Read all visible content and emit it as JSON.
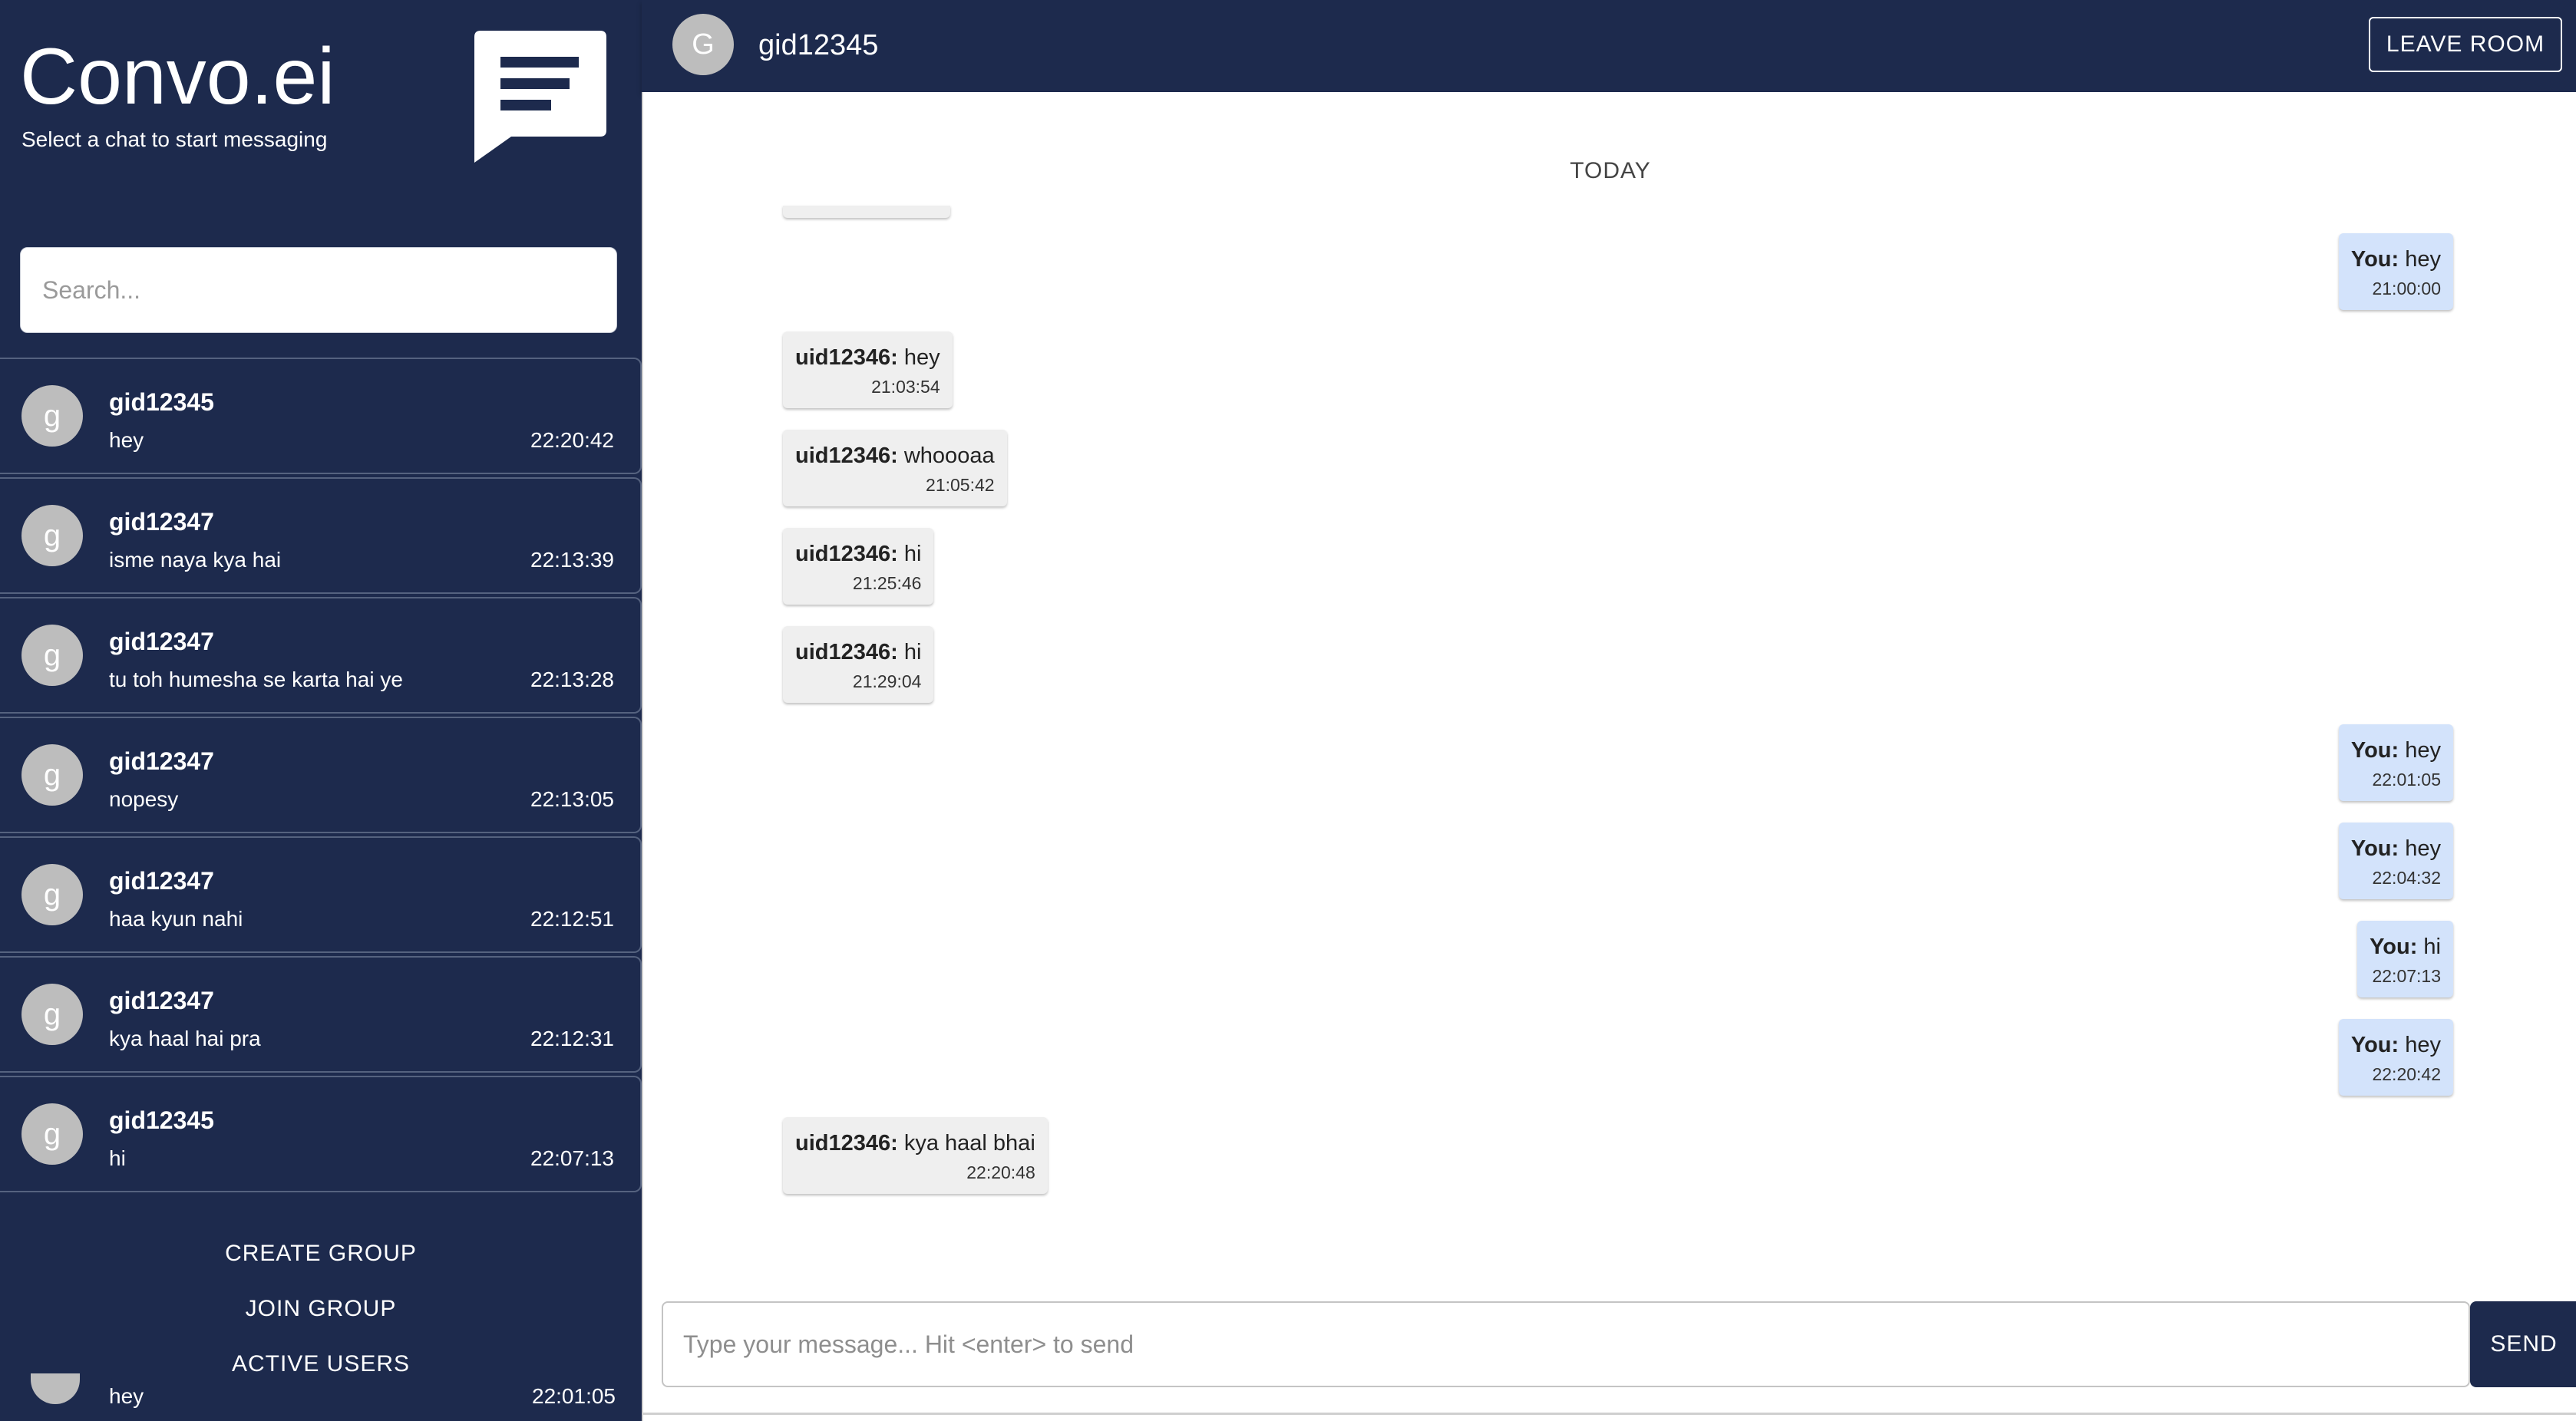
{
  "sidebar": {
    "brand_title": "Convo.ei",
    "brand_subtitle": "Select a chat to start messaging",
    "search_placeholder": "Search...",
    "conversations": [
      {
        "avatar": "g",
        "name": "gid12345",
        "last_message": "hey",
        "time": "22:20:42"
      },
      {
        "avatar": "g",
        "name": "gid12347",
        "last_message": "isme naya kya hai",
        "time": "22:13:39"
      },
      {
        "avatar": "g",
        "name": "gid12347",
        "last_message": "tu toh humesha se karta hai ye",
        "time": "22:13:28"
      },
      {
        "avatar": "g",
        "name": "gid12347",
        "last_message": "nopesy",
        "time": "22:13:05"
      },
      {
        "avatar": "g",
        "name": "gid12347",
        "last_message": "haa kyun nahi",
        "time": "22:12:51"
      },
      {
        "avatar": "g",
        "name": "gid12347",
        "last_message": "kya haal hai pra",
        "time": "22:12:31"
      },
      {
        "avatar": "g",
        "name": "gid12345",
        "last_message": "hi",
        "time": "22:07:13"
      }
    ],
    "partial_conversation": {
      "last_message": "hey",
      "time": "22:01:05"
    },
    "actions": {
      "create_group": "CREATE GROUP",
      "join_group": "JOIN GROUP",
      "active_users": "ACTIVE USERS"
    }
  },
  "header": {
    "avatar": "G",
    "room_name": "gid12345",
    "leave_button": "LEAVE ROOM"
  },
  "chat": {
    "day_separator": "TODAY",
    "messages": [
      {
        "direction": "out",
        "sender": "You:",
        "text": "hey",
        "time": "21:00:00"
      },
      {
        "direction": "in",
        "sender": "uid12346:",
        "text": "hey",
        "time": "21:03:54"
      },
      {
        "direction": "in",
        "sender": "uid12346:",
        "text": "whoooaa",
        "time": "21:05:42"
      },
      {
        "direction": "in",
        "sender": "uid12346:",
        "text": "hi",
        "time": "21:25:46"
      },
      {
        "direction": "in",
        "sender": "uid12346:",
        "text": "hi",
        "time": "21:29:04"
      },
      {
        "direction": "out",
        "sender": "You:",
        "text": "hey",
        "time": "22:01:05"
      },
      {
        "direction": "out",
        "sender": "You:",
        "text": "hey",
        "time": "22:04:32"
      },
      {
        "direction": "out",
        "sender": "You:",
        "text": "hi",
        "time": "22:07:13"
      },
      {
        "direction": "out",
        "sender": "You:",
        "text": "hey",
        "time": "22:20:42"
      },
      {
        "direction": "in",
        "sender": "uid12346:",
        "text": "kya haal bhai",
        "time": "22:20:48"
      }
    ]
  },
  "composer": {
    "placeholder": "Type your message... Hit <enter> to send",
    "send_button": "SEND"
  },
  "colors": {
    "navy": "#1d2a4d",
    "incoming_bubble": "#efefef",
    "outgoing_bubble": "#d3e3fb",
    "avatar_gray": "#bdbdbd"
  }
}
